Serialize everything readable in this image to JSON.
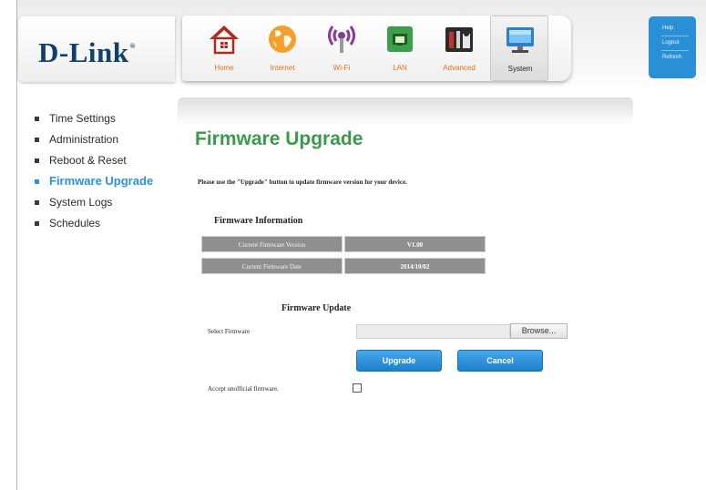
{
  "brand": {
    "logo_text": "D-Link",
    "logo_mark": "®"
  },
  "nav": {
    "items": [
      {
        "label": "Home",
        "icon": "home-icon"
      },
      {
        "label": "Internet",
        "icon": "globe-icon"
      },
      {
        "label": "Wi-Fi",
        "icon": "wifi-icon"
      },
      {
        "label": "LAN",
        "icon": "lan-port-icon"
      },
      {
        "label": "Advanced",
        "icon": "tools-icon"
      },
      {
        "label": "System",
        "icon": "monitor-icon"
      }
    ],
    "active": "System"
  },
  "utility": {
    "help": "Help",
    "logout": "Logout",
    "refresh": "Refresh"
  },
  "sidebar": {
    "items": [
      {
        "label": "Time Settings"
      },
      {
        "label": "Administration"
      },
      {
        "label": "Reboot & Reset"
      },
      {
        "label": "Firmware Upgrade"
      },
      {
        "label": "System Logs"
      },
      {
        "label": "Schedules"
      }
    ],
    "active": "Firmware Upgrade"
  },
  "main": {
    "title": "Firmware Upgrade",
    "instructions": "Please use the \"Upgrade\" button to update firmware version for your device.",
    "firmware_info": {
      "title": "Firmware Information",
      "rows": [
        {
          "label": "Current Firmware Version",
          "value": "V1.00"
        },
        {
          "label": "Current Firmware Date",
          "value": "2014/10/02"
        }
      ]
    },
    "firmware_update": {
      "title": "Firmware Update",
      "select_label": "Select Firmware",
      "file_value": "",
      "browse_label": "Browse...",
      "upgrade_label": "Upgrade",
      "cancel_label": "Cancel",
      "accept_label": "Accept unofficial firmware.",
      "accept_checked": false
    }
  },
  "colors": {
    "title_green": "#3b9a4a",
    "active_blue": "#2a92dd",
    "button_blue": "#1c80cc",
    "nav_orange": "#e07020",
    "logo_navy": "#123f6e"
  }
}
